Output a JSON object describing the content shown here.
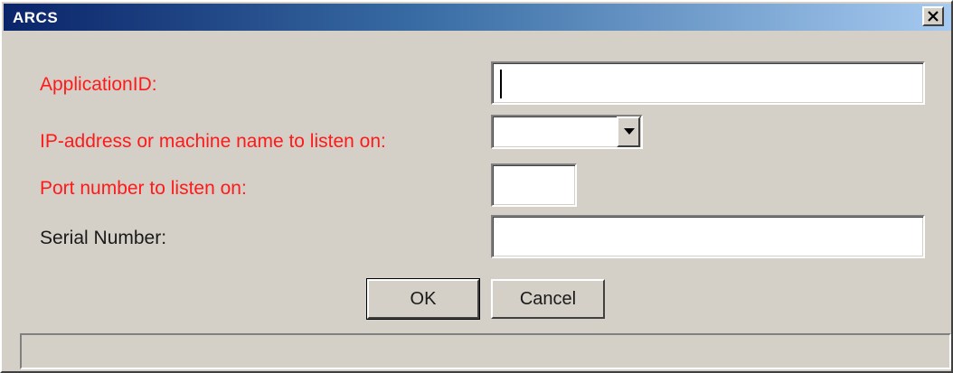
{
  "window": {
    "title": "ARCS"
  },
  "form": {
    "application_id": {
      "label": "ApplicationID:",
      "value": ""
    },
    "ip_address": {
      "label": "IP-address or machine name to listen on:",
      "value": ""
    },
    "port": {
      "label": "Port number to listen on:",
      "value": ""
    },
    "serial_number": {
      "label": "Serial Number:",
      "value": ""
    }
  },
  "buttons": {
    "ok_label": "OK",
    "cancel_label": "Cancel"
  },
  "statusbar": {
    "text": ""
  },
  "colors": {
    "required_label": "#ff1a1a",
    "titlebar_start": "#0a246a",
    "titlebar_end": "#a6caf0",
    "dialog_bg": "#d4d0c8"
  },
  "icons": {
    "close": "close-icon",
    "dropdown": "chevron-down-icon"
  }
}
